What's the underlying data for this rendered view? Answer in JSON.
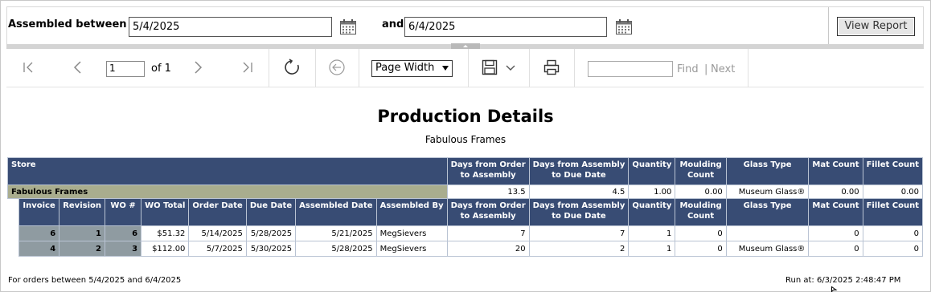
{
  "params": {
    "assembled_between_label": "Assembled between",
    "start_date": "5/4/2025",
    "and_label": "and",
    "end_date": "6/4/2025",
    "view_report_label": "View Report"
  },
  "toolbar": {
    "current_page": "1",
    "of_pages": "of 1",
    "zoom": "Page Width",
    "find_placeholder": "",
    "find_label": "Find",
    "separator": "|",
    "next_label": "Next"
  },
  "report": {
    "title": "Production Details",
    "subtitle": "Fabulous Frames",
    "store_header": {
      "store": "Store",
      "days_order_assembly_1": "Days from Order",
      "days_order_assembly_2": "to Assembly",
      "days_assembly_due_1": "Days from Assembly",
      "days_assembly_due_2": "to Due Date",
      "quantity": "Quantity",
      "moulding_1": "Moulding",
      "moulding_2": "Count",
      "glass_type": "Glass Type",
      "mat_count": "Mat Count",
      "fillet_count": "Fillet Count"
    },
    "store_row": {
      "name": "Fabulous Frames",
      "days_order_assembly": "13.5",
      "days_assembly_due": "4.5",
      "quantity": "1.00",
      "moulding": "0.00",
      "glass_type": "Museum Glass®",
      "mat_count": "0.00",
      "fillet_count": "0.00"
    },
    "detail_header": {
      "invoice": "Invoice",
      "revision": "Revision",
      "wo_num": "WO #",
      "wo_total": "WO Total",
      "order_date": "Order Date",
      "due_date": "Due Date",
      "assembled_date": "Assembled Date",
      "assembled_by": "Assembled By",
      "days_order_assembly_1": "Days from Order",
      "days_order_assembly_2": "to Assembly",
      "days_assembly_due_1": "Days from Assembly",
      "days_assembly_due_2": "to Due Date",
      "quantity": "Quantity",
      "moulding_1": "Moulding",
      "moulding_2": "Count",
      "glass_type": "Glass Type",
      "mat_count": "Mat Count",
      "fillet_count": "Fillet Count"
    },
    "rows": [
      {
        "invoice": "6",
        "revision": "1",
        "wo_num": "6",
        "wo_total": "$51.32",
        "order_date": "5/14/2025",
        "due_date": "5/28/2025",
        "assembled_date": "5/21/2025",
        "assembled_by": "MegSievers",
        "days_order_assembly": "7",
        "days_assembly_due": "7",
        "quantity": "1",
        "moulding": "0",
        "glass_type": "",
        "mat_count": "0",
        "fillet_count": "0"
      },
      {
        "invoice": "4",
        "revision": "2",
        "wo_num": "3",
        "wo_total": "$112.00",
        "order_date": "5/7/2025",
        "due_date": "5/30/2025",
        "assembled_date": "5/28/2025",
        "assembled_by": "MegSievers",
        "days_order_assembly": "20",
        "days_assembly_due": "2",
        "quantity": "1",
        "moulding": "0",
        "glass_type": "Museum Glass®",
        "mat_count": "0",
        "fillet_count": "0"
      }
    ],
    "footer_left": "For orders between 5/4/2025 and 6/4/2025",
    "footer_right": "Run at: 6/3/2025 2:48:47 PM"
  }
}
